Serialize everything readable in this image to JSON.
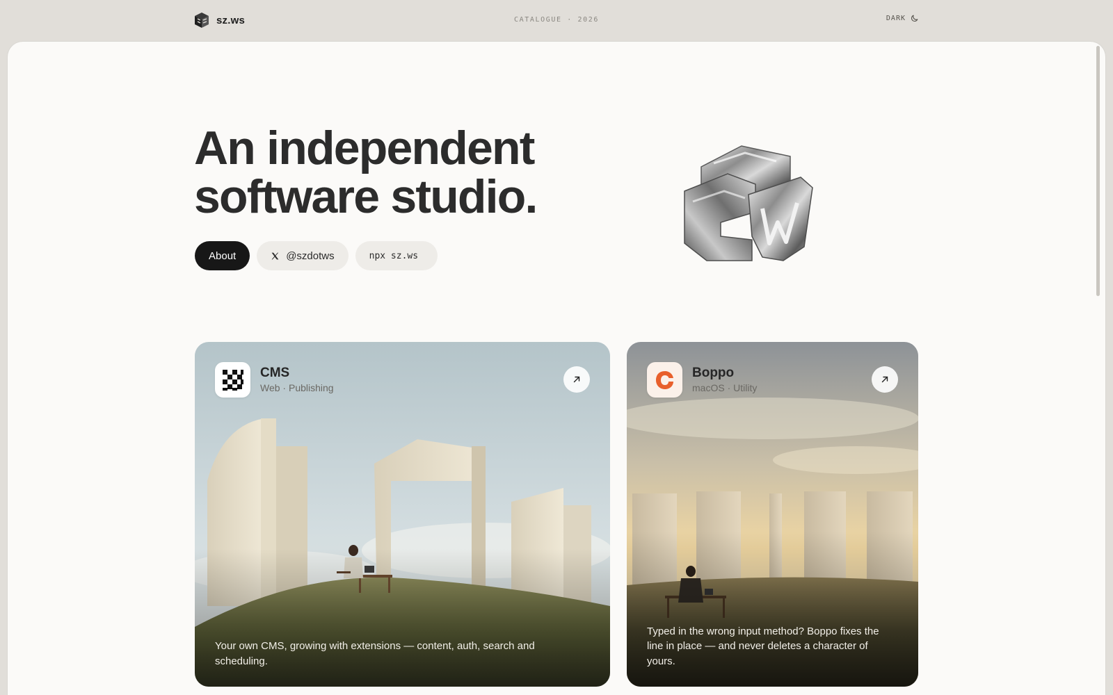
{
  "header": {
    "brand_name": "sz.ws",
    "catalogue_label": "CATALOGUE · 2026",
    "theme_toggle_label": "DARK",
    "theme_toggle_icon": "moon-icon"
  },
  "hero": {
    "title_line1": "An independent",
    "title_line2": "software studio.",
    "buttons": {
      "about_label": "About",
      "twitter_label": "@szdotws",
      "npx_label": "npx sz.ws"
    }
  },
  "cards": [
    {
      "title": "CMS",
      "meta": "Web · Publishing",
      "description": "Your own CMS, growing with extensions — content, auth, search and scheduling.",
      "icon": "checker-grid-icon",
      "arrow_icon": "arrow-up-right-icon"
    },
    {
      "title": "Boppo",
      "meta": "macOS · Utility",
      "description": "Typed in the wrong input method? Boppo fixes the line in place — and never deletes a character of yours.",
      "icon": "boppo-logo-icon",
      "arrow_icon": "arrow-up-right-icon"
    }
  ],
  "colors": {
    "page_background": "#e1ded9",
    "sheet_background": "#fbfaf8",
    "primary_button": "#171717",
    "secondary_button": "#eeece8",
    "boppo_accent": "#e8602c"
  }
}
